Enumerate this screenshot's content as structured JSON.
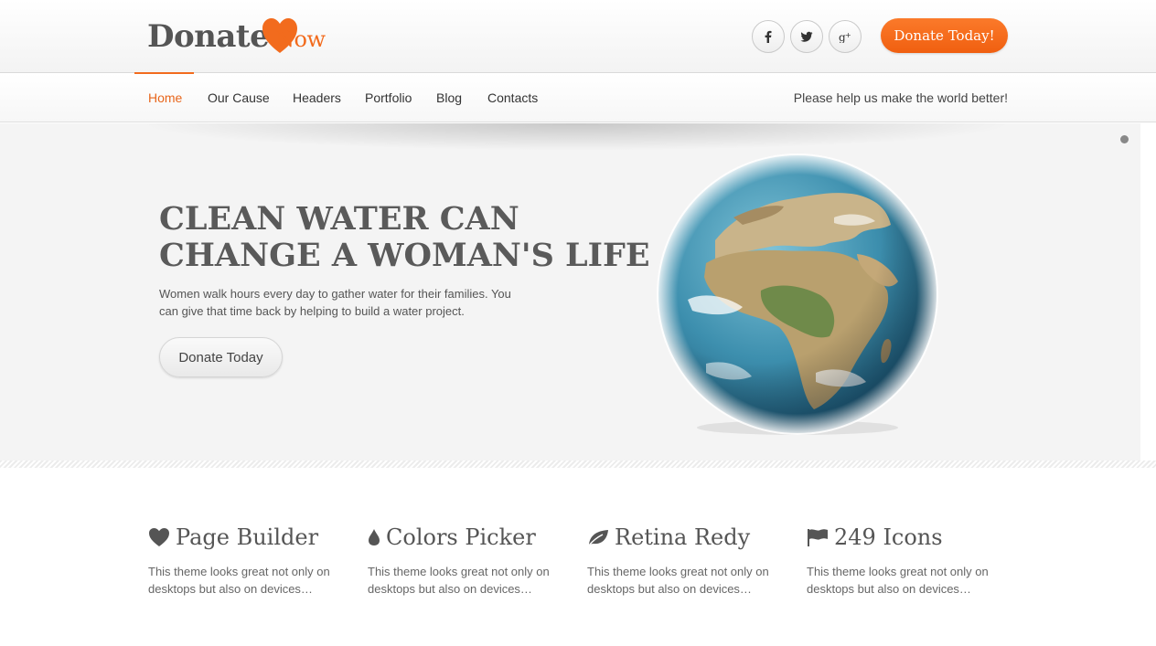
{
  "header": {
    "logo_word1": "Donate",
    "logo_word2": "Now",
    "donate_button": "Donate Today!",
    "socials": [
      {
        "icon": "facebook-icon"
      },
      {
        "icon": "twitter-icon"
      },
      {
        "icon": "google-plus-icon"
      }
    ]
  },
  "nav": {
    "items": [
      {
        "label": "Home",
        "active": true
      },
      {
        "label": "Our Cause"
      },
      {
        "label": "Headers"
      },
      {
        "label": "Portfolio"
      },
      {
        "label": "Blog"
      },
      {
        "label": "Contacts"
      }
    ],
    "tagline": "Please help us make the world better!"
  },
  "hero": {
    "title_line1": "CLEAN WATER CAN",
    "title_line2": "CHANGE A WOMAN'S LIFE",
    "text": "Women walk hours every day to gather water for their families. You can give that time back by helping to build a water project.",
    "button": "Donate Today"
  },
  "features": [
    {
      "icon": "heart-icon",
      "title": "Page Builder",
      "text": "This theme looks great not only on desktops but also on devices…"
    },
    {
      "icon": "drop-icon",
      "title": "Colors Picker",
      "text": "This theme looks great not only on desktops but also on devices…"
    },
    {
      "icon": "leaf-icon",
      "title": "Retina Redy",
      "text": "This theme looks great not only on desktops but also on devices…"
    },
    {
      "icon": "flag-icon",
      "title": "249 Icons",
      "text": "This theme looks great not only on desktops but also on devices…"
    }
  ],
  "colors": {
    "accent": "#f26b1d",
    "text": "#555555",
    "hero_bg": "#f4f4f4"
  }
}
